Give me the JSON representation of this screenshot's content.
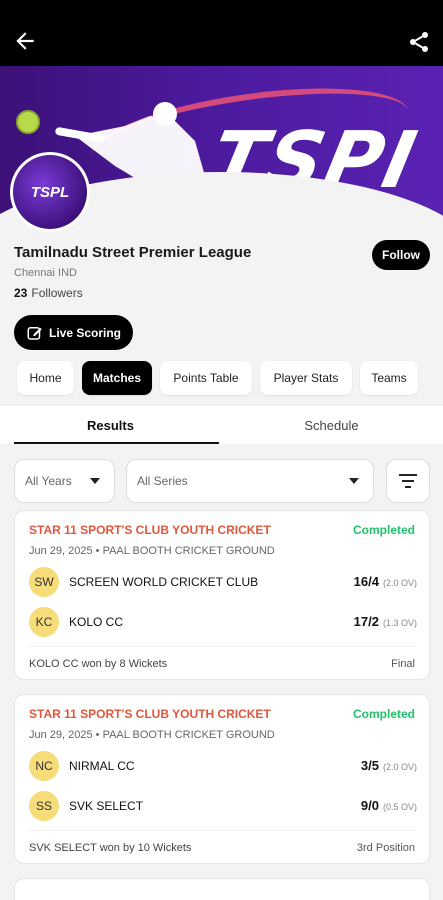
{
  "header": {
    "back_icon": "arrow-left-icon",
    "share_icon": "share-icon"
  },
  "banner": {
    "brand_text": "TSPI",
    "logo_text": "TSPL"
  },
  "league": {
    "name": "Tamilnadu Street Premier League",
    "location": "Chennai IND",
    "followers_count": "23",
    "followers_label": "Followers",
    "follow_label": "Follow"
  },
  "live_scoring_label": "Live Scoring",
  "tabs": [
    {
      "label": "Home"
    },
    {
      "label": "Matches"
    },
    {
      "label": "Points Table"
    },
    {
      "label": "Player Stats"
    },
    {
      "label": "Teams"
    }
  ],
  "subtabs": [
    {
      "label": "Results"
    },
    {
      "label": "Schedule"
    }
  ],
  "filters": {
    "years": "All Years",
    "series": "All Series"
  },
  "matches": [
    {
      "series": "STAR 11 SPORT'S CLUB YOUTH CRICKET",
      "status": "Completed",
      "meta": "Jun 29, 2025  •  PAAL BOOTH CRICKET GROUND",
      "team1": {
        "abbr": "SW",
        "name": "SCREEN WORLD CRICKET CLUB",
        "score": "16/4",
        "overs": "(2.0 OV)"
      },
      "team2": {
        "abbr": "KC",
        "name": "KOLO CC",
        "score": "17/2",
        "overs": "(1.3 OV)"
      },
      "result": "KOLO CC won by 8 Wickets",
      "stage": "Final"
    },
    {
      "series": "STAR 11 SPORT'S CLUB YOUTH CRICKET",
      "status": "Completed",
      "meta": "Jun 29, 2025  •  PAAL BOOTH CRICKET GROUND",
      "team1": {
        "abbr": "NC",
        "name": "NIRMAL CC",
        "score": "3/5",
        "overs": "(2.0 OV)"
      },
      "team2": {
        "abbr": "SS",
        "name": "SVK SELECT",
        "score": "9/0",
        "overs": "(0.5 OV)"
      },
      "result": "SVK SELECT won by 10 Wickets",
      "stage": "3rd Position"
    }
  ],
  "colors": {
    "accent": "#000000",
    "series_red": "#e0573c",
    "status_green": "#23c16b",
    "banner_purple": "#4b1a9c",
    "badge_yellow": "#f7dc7a"
  }
}
